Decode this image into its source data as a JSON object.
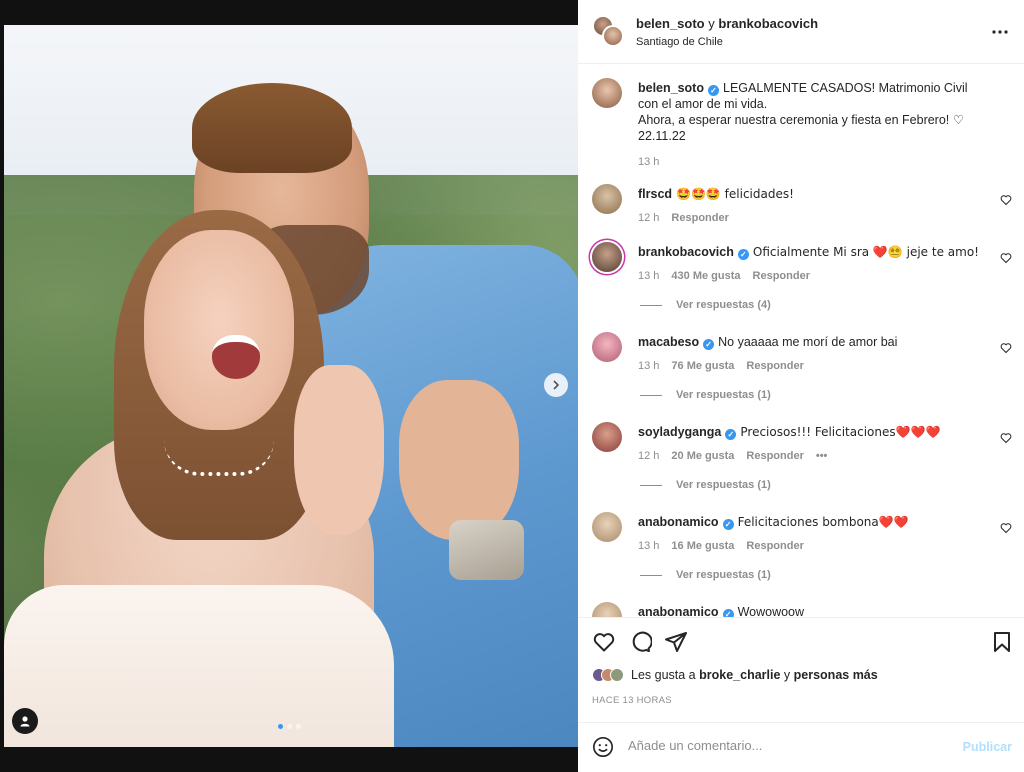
{
  "header": {
    "user1": "belen_soto",
    "conj": "y",
    "user2": "brankobacovich",
    "location": "Santiago de Chile",
    "more_icon": "more-horizontal-icon"
  },
  "caption": {
    "username": "belen_soto",
    "line1": "LEGALMENTE CASADOS! Matrimonio Civil con el amor de mi vida.",
    "line2": "Ahora, a esperar nuestra ceremonia y fiesta en Febrero! ♡",
    "line3": "22.11.22",
    "time": "13 h"
  },
  "comments": [
    {
      "username": "flrscd",
      "verified": false,
      "text": "🤩🤩🤩 felicidades!",
      "time": "12 h",
      "likes": "",
      "reply": "Responder",
      "replies": ""
    },
    {
      "username": "brankobacovich",
      "verified": true,
      "text": "Oficialmente Mi sra ❤️😵‍💫 jeje te amo!",
      "time": "13 h",
      "likes": "430 Me gusta",
      "reply": "Responder",
      "replies": "Ver respuestas (4)"
    },
    {
      "username": "macabeso",
      "verified": true,
      "text": "No yaaaaa me morí de amor bai",
      "time": "13 h",
      "likes": "76 Me gusta",
      "reply": "Responder",
      "replies": "Ver respuestas (1)"
    },
    {
      "username": "soyladyganga",
      "verified": true,
      "text": "Preciosos!!! Felicitaciones❤️❤️❤️",
      "time": "12 h",
      "likes": "20 Me gusta",
      "reply": "Responder",
      "replies": "Ver respuestas (1)",
      "options": "•••"
    },
    {
      "username": "anabonamico",
      "verified": true,
      "text": "Felicitaciones bombona❤️❤️",
      "time": "13 h",
      "likes": "16 Me gusta",
      "reply": "Responder",
      "replies": "Ver respuestas (1)"
    },
    {
      "username": "anabonamico",
      "verified": true,
      "text": "Wowowoow",
      "time": "",
      "likes": "",
      "reply": "",
      "replies": ""
    }
  ],
  "likes": {
    "prefix": "Les gusta a",
    "user": "broke_charlie",
    "middle": "y",
    "suffix": "personas más"
  },
  "post_time": "HACE 13 HORAS",
  "add_comment": {
    "placeholder": "Añade un comentario...",
    "publish": "Publicar"
  },
  "icons": {
    "like": "heart-icon",
    "comment": "comment-icon",
    "share": "share-icon",
    "save": "bookmark-icon",
    "emoji": "smile-icon",
    "next": "chevron-right-icon",
    "tags": "user-tag-icon"
  },
  "colors": {
    "verified": "#3897f0",
    "publish": "#b2dffc",
    "muted": "#8e8e8e",
    "heart": "#e0245e"
  }
}
